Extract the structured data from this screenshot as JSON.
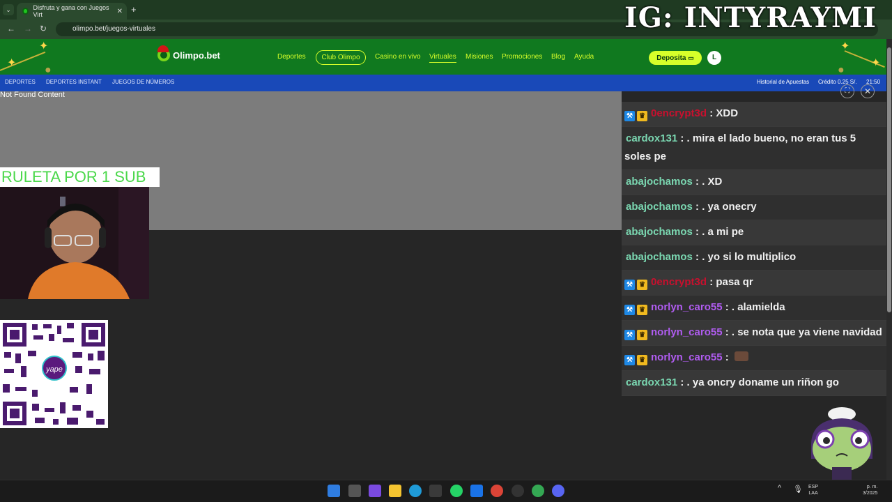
{
  "browser": {
    "tab_title": "Disfruta y gana con Juegos Virt",
    "tab_close": "✕",
    "new_tab": "+",
    "tab_list": "⌄",
    "back": "←",
    "forward": "→",
    "reload": "↻",
    "url": "olimpo.bet/juegos-virtuales"
  },
  "overlay": {
    "ig_text": "IG: INTYRAYMI",
    "ruleta": "RULETA POR 1 SUB",
    "qr_logo": "yape"
  },
  "site": {
    "logo": "Olimpo.bet",
    "nav": [
      "Deportes",
      "Club Olimpo",
      "Casino en vivo",
      "Virtuales",
      "Misiones",
      "Promociones",
      "Blog",
      "Ayuda"
    ],
    "deposita": "Deposita",
    "avatar_initial": "L",
    "subnav": [
      "DEPORTES",
      "DEPORTES INSTANT",
      "JUEGOS DE NÚMEROS"
    ],
    "historial": "Historial de Apuestas",
    "credito": "Crédito 0.25 S/.",
    "hora": "21:50",
    "not_found": "Not Found Content",
    "expand_icon": "⛶",
    "close_icon": "✕"
  },
  "chat": [
    {
      "user": "0encrypt3d",
      "color": "#c8102e",
      "badges": true,
      "text": ": XDD",
      "shade": "light"
    },
    {
      "user": "cardox131",
      "color": "#7ad6b0",
      "badges": false,
      "text": ": . mira el lado bueno, no eran tus 5 soles pe",
      "shade": "dark"
    },
    {
      "user": "abajochamos",
      "color": "#7ad6b0",
      "badges": false,
      "text": ": . XD",
      "shade": "light"
    },
    {
      "user": "abajochamos",
      "color": "#7ad6b0",
      "badges": false,
      "text": ": . ya onecry",
      "shade": "dark"
    },
    {
      "user": "abajochamos",
      "color": "#7ad6b0",
      "badges": false,
      "text": ": . a mi pe",
      "shade": "light"
    },
    {
      "user": "abajochamos",
      "color": "#7ad6b0",
      "badges": false,
      "text": ": . yo si lo multiplico",
      "shade": "dark"
    },
    {
      "user": "0encrypt3d",
      "color": "#c8102e",
      "badges": true,
      "text": ": pasa qr",
      "shade": "light"
    },
    {
      "user": "norlyn_caro55",
      "color": "#b05cf0",
      "badges": true,
      "text": ": . alamielda",
      "shade": "dark"
    },
    {
      "user": "norlyn_caro55",
      "color": "#b05cf0",
      "badges": true,
      "text": ": . se nota que ya viene navidad",
      "shade": "light"
    },
    {
      "user": "norlyn_caro55",
      "color": "#b05cf0",
      "badges": true,
      "text": ":",
      "shade": "dark",
      "emote": true
    },
    {
      "user": "cardox131",
      "color": "#7ad6b0",
      "badges": false,
      "text": ": . ya oncry doname un riñon go",
      "shade": "light"
    }
  ],
  "taskbar": {
    "tray_arrow": "^",
    "lang_line1": "ESP",
    "lang_line2": "LAA",
    "clock_line1": "p. m.",
    "clock_line2": "3/2025"
  }
}
